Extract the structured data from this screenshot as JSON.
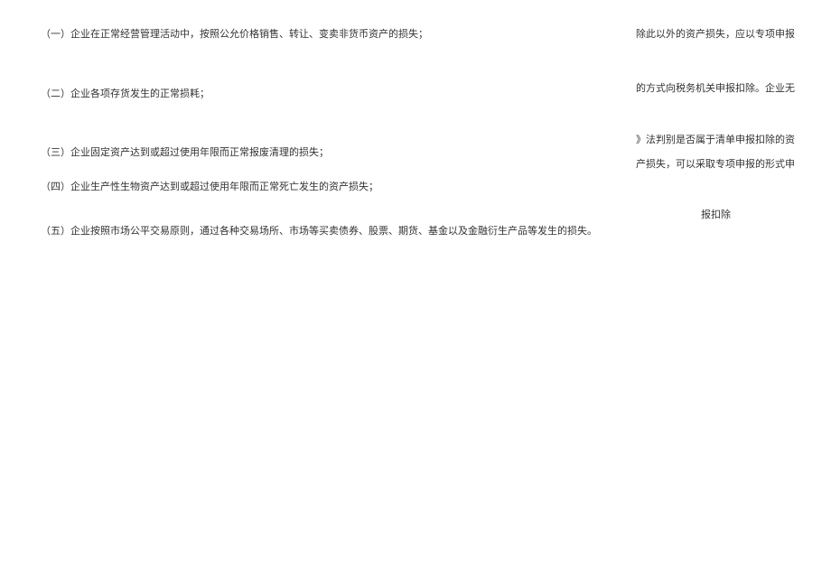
{
  "left": {
    "item1": "（一）企业在正常经营管理活动中，按照公允价格销售、转让、变卖非货币资产的损失；",
    "item2": "（二）企业各项存货发生的正常损耗；",
    "item3": "（三）企业固定资产达到或超过使用年限而正常报废清理的损失；",
    "item4": "（四）企业生产性生物资产达到或超过使用年限而正常死亡发生的资产损失；",
    "item5": "（五）企业按照市场公平交易原则，通过各种交易场所、市场等买卖债券、股票、期货、基金以及金融衍生产品等发生的损失。"
  },
  "right": {
    "line1": "除此以外的资产损失，应以专项申报",
    "line2": "的方式向税务机关申报扣除。企业无",
    "line3": "》法判别是否属于清单申报扣除的资",
    "line4": "产损失，可以采取专项申报的形式申",
    "line5": "报扣除"
  }
}
